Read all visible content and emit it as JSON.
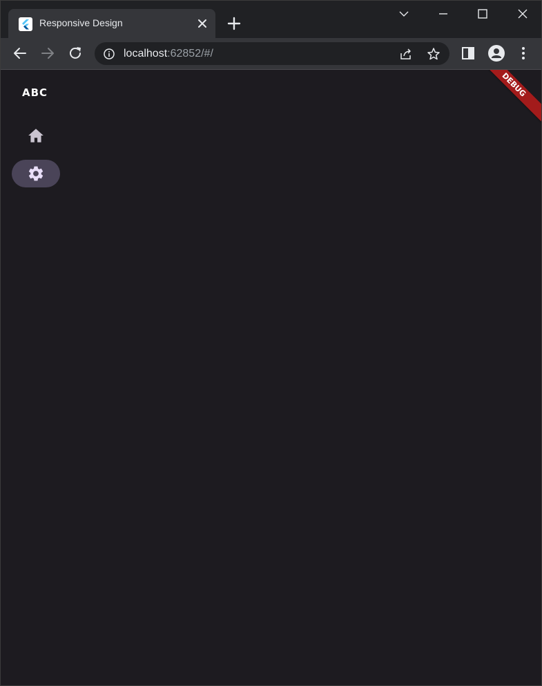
{
  "browser": {
    "tab": {
      "title": "Responsive Design",
      "favicon": "flutter-logo-icon",
      "close_icon": "close-icon"
    },
    "new_tab_icon": "plus-icon",
    "window_controls": [
      "chevron-down-icon",
      "minimize-icon",
      "maximize-icon",
      "close-icon"
    ],
    "toolbar": {
      "back_icon": "arrow-left-icon",
      "forward_icon": "arrow-right-icon",
      "reload_icon": "reload-icon",
      "url_host": "localhost",
      "url_rest": ":62852/#/",
      "info_icon": "info-icon",
      "share_icon": "share-icon",
      "bookmark_icon": "star-icon",
      "side_panel_icon": "side-panel-icon",
      "profile_icon": "profile-icon",
      "menu_icon": "more-vert-icon"
    }
  },
  "app": {
    "logo_text": "ABC",
    "nav_rail": {
      "items": [
        {
          "icon": "home-icon",
          "selected": false
        },
        {
          "icon": "settings-icon",
          "selected": true
        }
      ]
    },
    "debug_banner": "DEBUG"
  },
  "colors": {
    "background": "#1d1b20",
    "nav_selected_indicator": "#4a4458",
    "nav_icon_selected": "#e8def8",
    "nav_icon": "#cac4d0",
    "debug_banner": "#a31b1b",
    "chrome_tab_strip": "#202124",
    "chrome_toolbar": "#35363a"
  }
}
